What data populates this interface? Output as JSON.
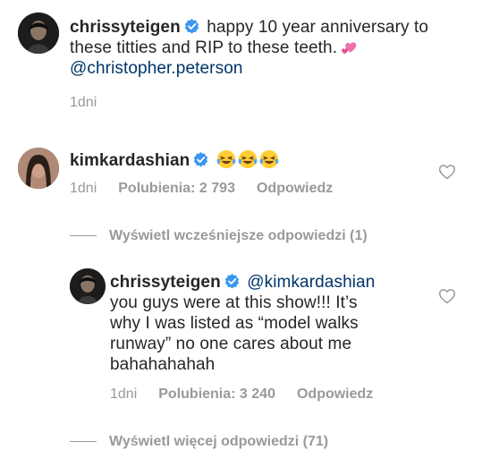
{
  "caption": {
    "username": "chrissyteigen",
    "text_line1": "happy 10 year anniversary to",
    "text_line2": "these titties and RIP to these teeth.",
    "mention": "@christopher.peterson",
    "emoji": "two-hearts",
    "time": "1dni"
  },
  "comment": {
    "username": "kimkardashian",
    "emojis": [
      "laughing-tears",
      "laughing-tears",
      "laughing-tears"
    ],
    "time": "1dni",
    "likes": "Polubienia: 2 793",
    "reply_label": "Odpowiedz"
  },
  "view_earlier": {
    "label": "Wyświetl wcześniejsze odpowiedzi (1)"
  },
  "reply": {
    "username": "chrissyteigen",
    "mention": "@kimkardashian",
    "line1": "you guys were at this show!!! It’s",
    "line2": "why I was listed as “model walks",
    "line3": "runway” no one cares about me",
    "line4": "bahahahahah",
    "time": "1dni",
    "likes": "Polubienia: 3 240",
    "reply_label": "Odpowiedz"
  },
  "view_more": {
    "label": "Wyświetl więcej odpowiedzi (71)"
  },
  "colors": {
    "text": "#262626",
    "meta": "#999999",
    "mention": "#003569",
    "verified": "#3897f0"
  }
}
